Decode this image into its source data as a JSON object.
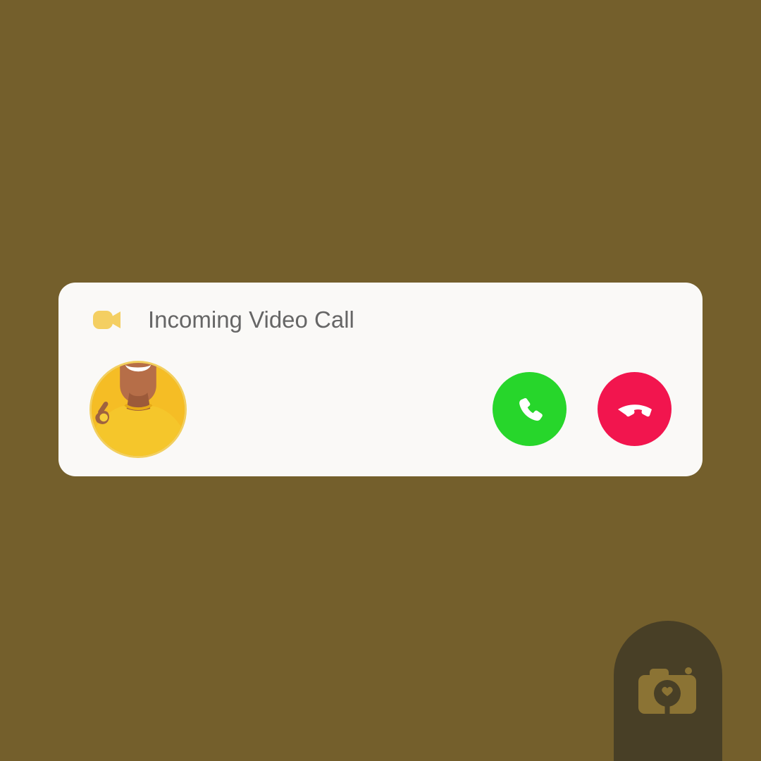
{
  "notification": {
    "title": "Incoming Video Call",
    "icon": "video-camera-icon",
    "accent_color": "#f4cf62"
  },
  "caller": {
    "avatar": "caller-avatar"
  },
  "actions": {
    "accept": {
      "icon": "phone-icon",
      "color": "#27d62b"
    },
    "decline": {
      "icon": "phone-hangup-icon",
      "color": "#f2154e"
    }
  },
  "branding": {
    "watermark_icon": "camera-logo-icon"
  }
}
